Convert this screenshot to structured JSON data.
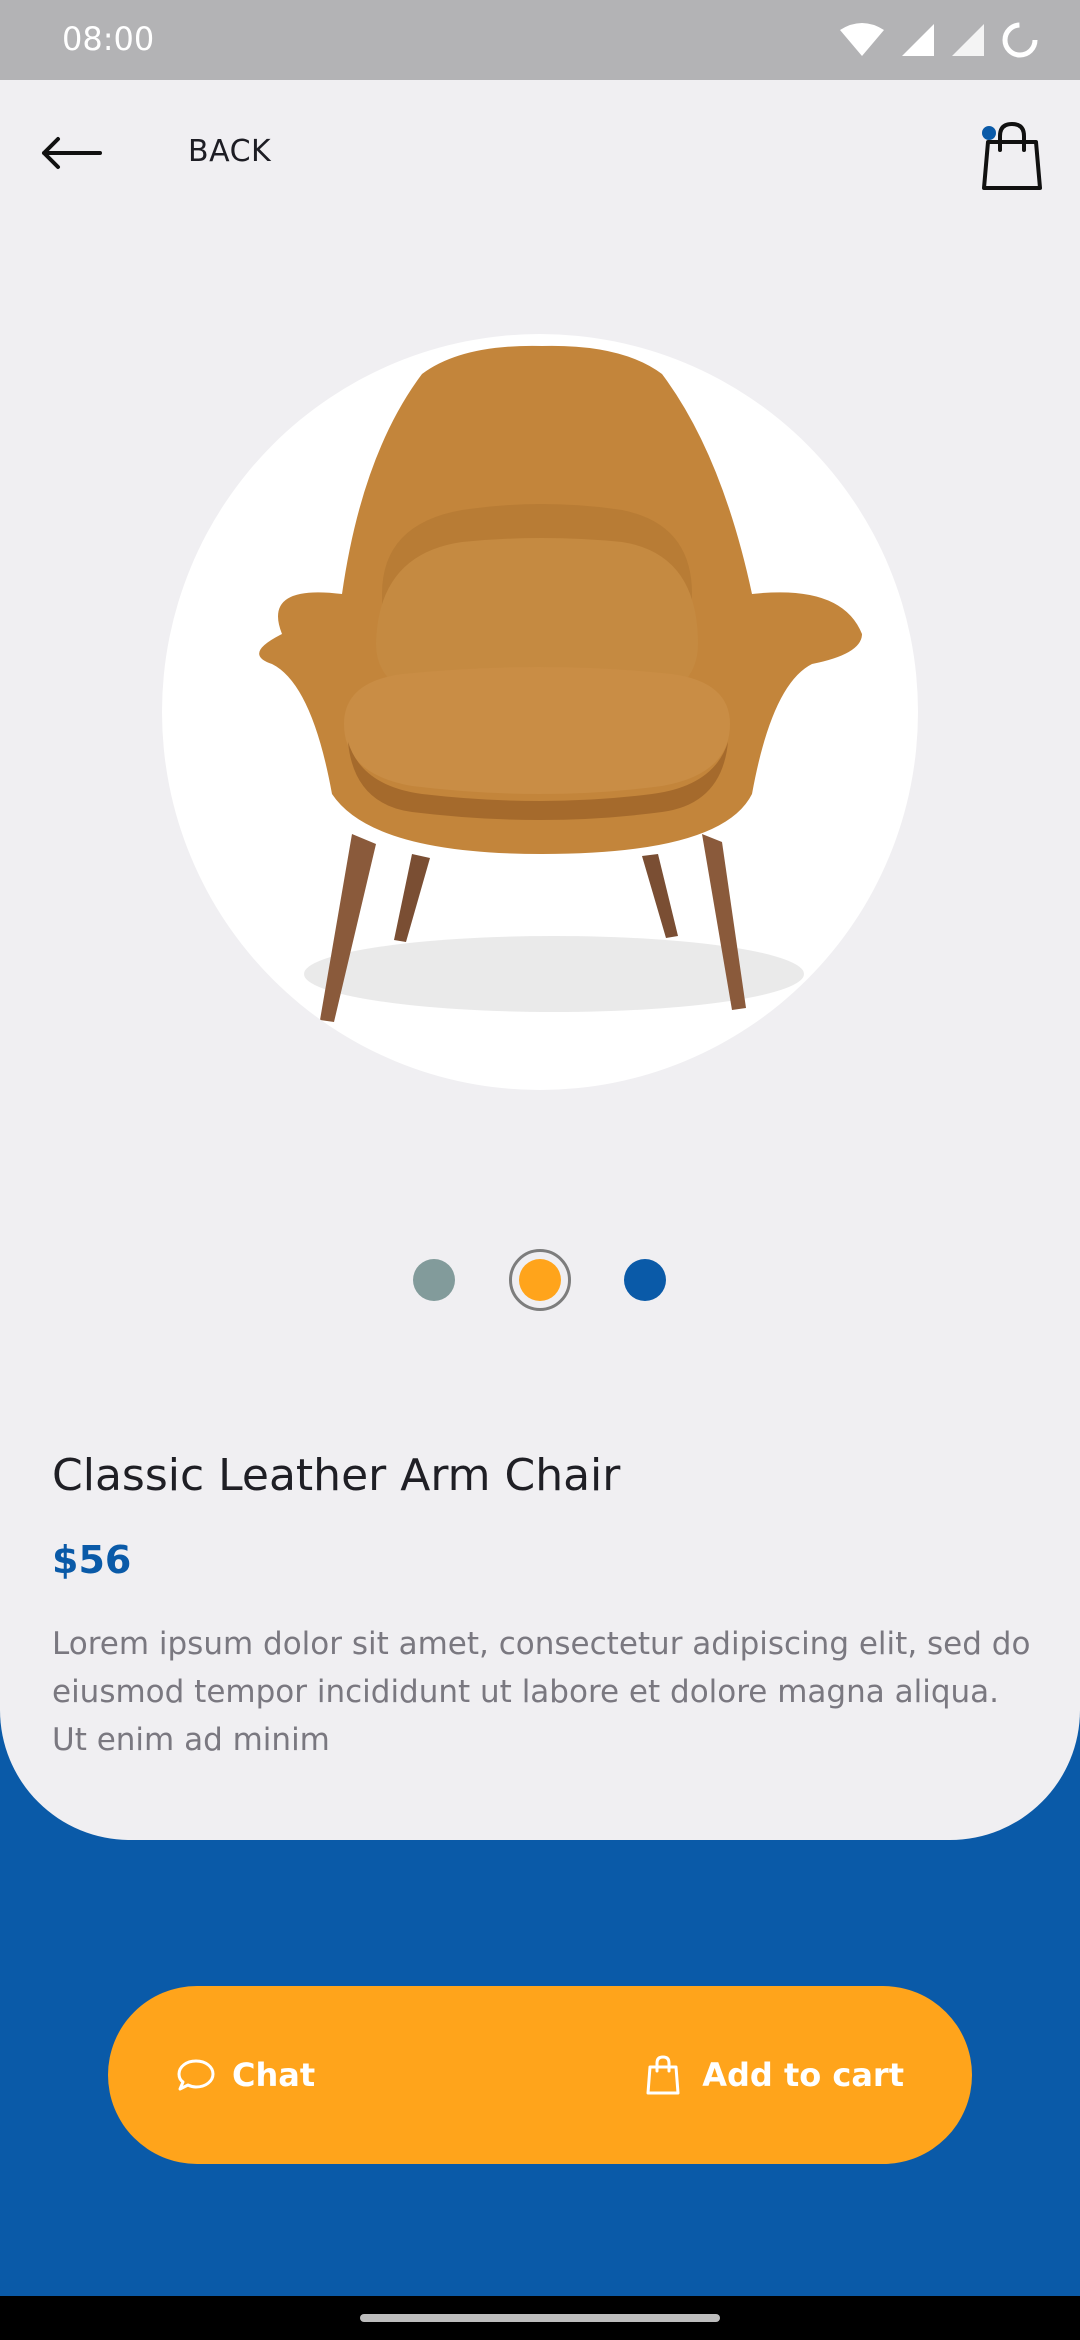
{
  "status_bar": {
    "time": "08:00"
  },
  "header": {
    "back_label": "BACK"
  },
  "product": {
    "title": "Classic Leather Arm Chair",
    "price": "$56",
    "description": "Lorem ipsum dolor sit amet, consectetur adipiscing elit, sed do eiusmod tempor incididunt ut labore et dolore magna aliqua. Ut enim ad minim",
    "colors": [
      "#829b9b",
      "#ffa41b",
      "#0a5aa8"
    ],
    "selected_color_index": 1
  },
  "actions": {
    "chat_label": "Chat",
    "add_to_cart_label": "Add to cart"
  },
  "theme": {
    "primary": "#0a5aa8",
    "accent": "#ffa41b",
    "sheet_bg": "#f0eff2"
  }
}
